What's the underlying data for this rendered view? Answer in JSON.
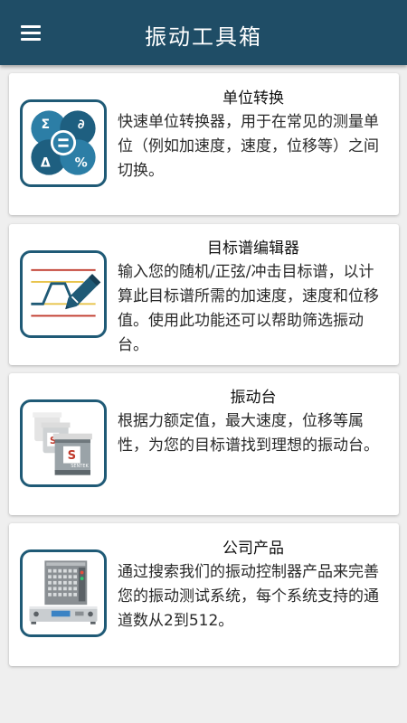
{
  "appbar": {
    "title": "振动工具箱",
    "menu_icon": "hamburger-menu-icon",
    "color": "#1f4d66"
  },
  "cards": [
    {
      "title": "单位转换",
      "desc": "快速单位转换器，用于在常见的测量单位（例如加速度，速度，位移等）之间切换。",
      "icon": "unit-converter-icon"
    },
    {
      "title": "目标谱编辑器",
      "desc": "输入您的随机/正弦/冲击目标谱，以计算此目标谱所需的加速度，速度和位移值。使用此功能还可以帮助筛选振动台。",
      "icon": "profile-editor-icon"
    },
    {
      "title": "振动台",
      "desc": "根据力额定值，最大速度，位移等属性，为您的目标谱找到理想的振动台。",
      "icon": "shakers-icon",
      "icon_label": "SENTEK"
    },
    {
      "title": "公司产品",
      "desc": "通过搜索我们的振动控制器产品来完善您的振动测试系统，每个系统支持的通道数从2到512。",
      "icon": "controller-products-icon"
    }
  ]
}
